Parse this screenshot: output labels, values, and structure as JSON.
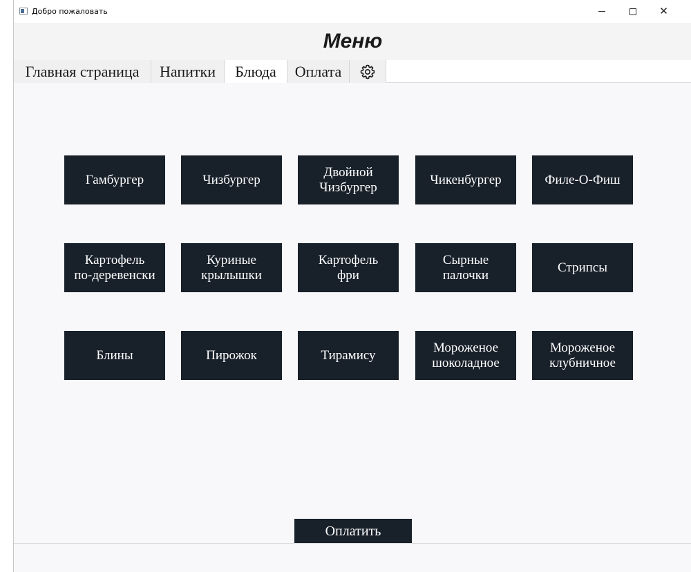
{
  "window": {
    "title": "Добро пожаловать",
    "minimize": "–",
    "close": "✕"
  },
  "header": {
    "title": "Меню"
  },
  "tabs": [
    {
      "label": "Главная страница"
    },
    {
      "label": "Напитки"
    },
    {
      "label": "Блюда"
    },
    {
      "label": "Оплата"
    },
    {
      "label": "",
      "icon": "gear-icon"
    }
  ],
  "dishes": [
    {
      "label": "Гамбургер"
    },
    {
      "label": "Чизбургер"
    },
    {
      "label": "Двойной\nЧизбургер"
    },
    {
      "label": "Чикенбургер"
    },
    {
      "label": "Филе-О-Фиш"
    },
    {
      "label": "Картофель\nпо-деревенски"
    },
    {
      "label": "Куриные\nкрылышки"
    },
    {
      "label": "Картофель\nфри"
    },
    {
      "label": "Сырные\nпалочки"
    },
    {
      "label": "Стрипсы"
    },
    {
      "label": "Блины"
    },
    {
      "label": "Пирожок"
    },
    {
      "label": "Тирамису"
    },
    {
      "label": "Мороженое\nшоколадное"
    },
    {
      "label": "Мороженое\nклубничное"
    }
  ],
  "pay_button": {
    "label": "Оплатить"
  },
  "colors": {
    "button_bg": "#18202a",
    "button_text": "#ffffff",
    "content_bg": "#f8f8fb"
  }
}
